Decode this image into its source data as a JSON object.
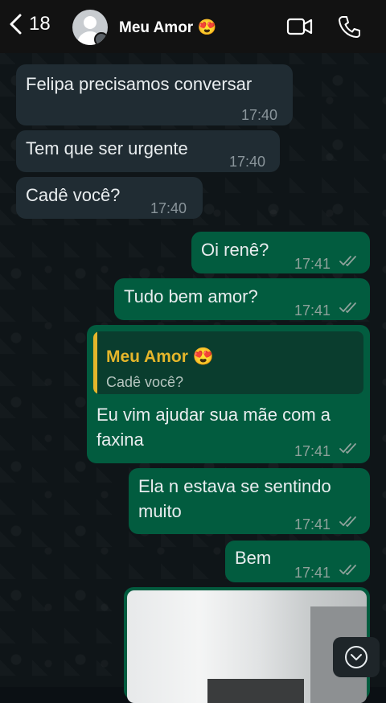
{
  "header": {
    "back_count": "18",
    "contact_name": "Meu Amor 😍"
  },
  "messages": [
    {
      "text": "Felipa precisamos conversar",
      "time": "17:40"
    },
    {
      "text": "Tem que ser urgente",
      "time": "17:40"
    },
    {
      "text": "Cadê você?",
      "time": "17:40"
    },
    {
      "text": "Oi renê?",
      "time": "17:41"
    },
    {
      "text": "Tudo bem amor?",
      "time": "17:41"
    },
    {
      "quote_name": "Meu Amor 😍",
      "quote_text": "Cadê você?",
      "line1": "Eu vim ajudar sua mãe com a",
      "line2": "faxina",
      "time": "17:41"
    },
    {
      "line1": "Ela n estava se sentindo",
      "line2": "muito",
      "time": "17:41"
    },
    {
      "text": "Bem",
      "time": "17:41"
    }
  ],
  "icons": {
    "back": "chevron-left-icon",
    "video": "video-camera-icon",
    "call": "phone-icon",
    "read": "double-check-icon",
    "scroll": "chevron-down-circle-icon"
  }
}
